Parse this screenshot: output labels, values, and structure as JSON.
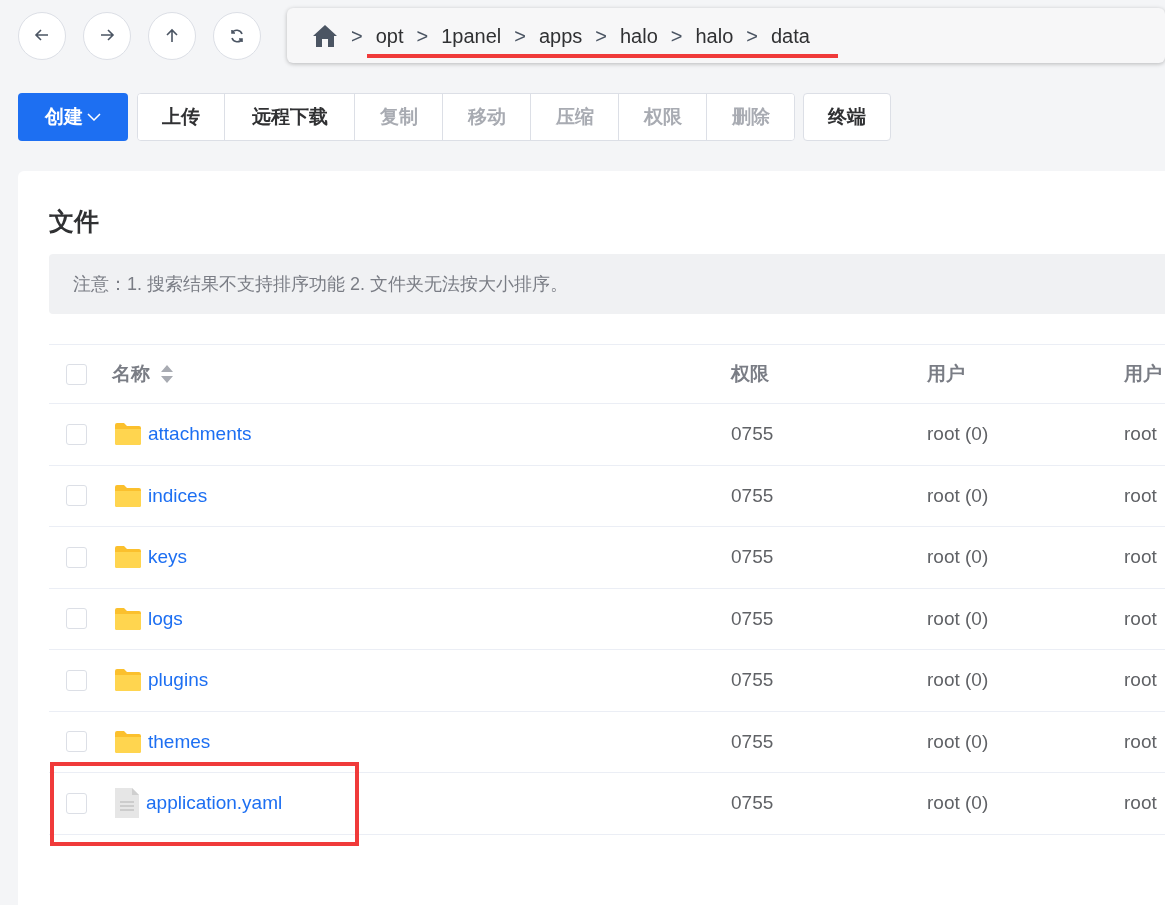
{
  "nav_buttons": [
    {
      "kind": "back"
    },
    {
      "kind": "forward"
    },
    {
      "kind": "up"
    },
    {
      "kind": "refresh"
    }
  ],
  "breadcrumb": [
    {
      "separator": ">",
      "label": "opt"
    },
    {
      "separator": ">",
      "label": "1panel"
    },
    {
      "separator": ">",
      "label": "apps"
    },
    {
      "separator": ">",
      "label": "halo"
    },
    {
      "separator": ">",
      "label": "halo"
    },
    {
      "separator": ">",
      "label": "data"
    }
  ],
  "create_button": {
    "label": "创建"
  },
  "actions": [
    {
      "label": "上传",
      "disabled": false
    },
    {
      "label": "远程下载",
      "disabled": false
    },
    {
      "label": "复制",
      "disabled": true
    },
    {
      "label": "移动",
      "disabled": true
    },
    {
      "label": "压缩",
      "disabled": true
    },
    {
      "label": "权限",
      "disabled": true
    },
    {
      "label": "删除",
      "disabled": true
    }
  ],
  "terminal_button": {
    "label": "终端"
  },
  "card": {
    "title": "文件",
    "notice": "注意：1. 搜索结果不支持排序功能 2. 文件夹无法按大小排序。"
  },
  "table": {
    "header_checked": false,
    "columns": [
      {
        "label": "名称",
        "sortable": true
      },
      {
        "label": "权限",
        "sortable": false
      },
      {
        "label": "用户",
        "sortable": false
      },
      {
        "label": "用户",
        "sortable": false
      }
    ],
    "rows": [
      {
        "kind": "folder",
        "checked": false,
        "name": "attachments",
        "permission": "0755",
        "user": "root (0)",
        "column_4": "root"
      },
      {
        "kind": "folder",
        "checked": false,
        "name": "indices",
        "permission": "0755",
        "user": "root (0)",
        "column_4": "root"
      },
      {
        "kind": "folder",
        "checked": false,
        "name": "keys",
        "permission": "0755",
        "user": "root (0)",
        "column_4": "root"
      },
      {
        "kind": "folder",
        "checked": false,
        "name": "logs",
        "permission": "0755",
        "user": "root (0)",
        "column_4": "root"
      },
      {
        "kind": "folder",
        "checked": false,
        "name": "plugins",
        "permission": "0755",
        "user": "root (0)",
        "column_4": "root"
      },
      {
        "kind": "folder",
        "checked": false,
        "name": "themes",
        "permission": "0755",
        "user": "root (0)",
        "column_4": "root"
      },
      {
        "kind": "file",
        "checked": false,
        "name": "application.yaml",
        "permission": "0755",
        "user": "root (0)",
        "column_4": "root"
      }
    ]
  }
}
